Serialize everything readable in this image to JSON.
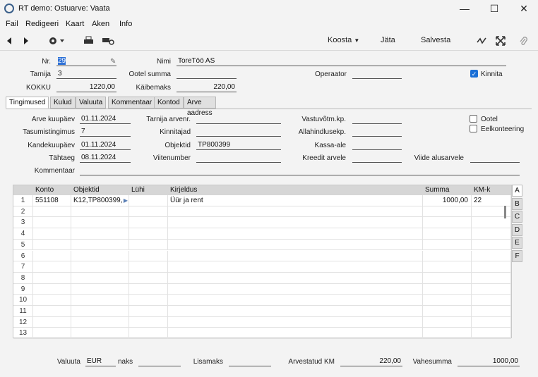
{
  "window": {
    "title": "RT demo: Ostuarve: Vaata",
    "minimize": "—",
    "maximize": "☐",
    "close": "✕"
  },
  "menu": [
    "Fail",
    "Redigeeri",
    "Kaart",
    "Aken",
    "Info"
  ],
  "toolbar": {
    "koosta": "Koosta",
    "jata": "Jäta",
    "salvesta": "Salvesta"
  },
  "header": {
    "nr_label": "Nr.",
    "nr_value": "29",
    "nimi_label": "Nimi",
    "nimi_value": "ToreTöö AS",
    "tarnija_label": "Tarnija",
    "tarnija_value": "3",
    "ootel_summa_label": "Ootel summa",
    "ootel_summa_value": "",
    "operaator_label": "Operaator",
    "operaator_value": "",
    "kinnita_label": "Kinnita",
    "kokku_label": "KOKKU",
    "kokku_value": "1220,00",
    "kaibemaks_label": "Käibemaks",
    "kaibemaks_value": "220,00"
  },
  "tabs": [
    "Tingimused",
    "Kulud",
    "Valuuta",
    "Kommentaar",
    "Kontod",
    "Arve aadress"
  ],
  "conditions": {
    "arve_kuupaev_label": "Arve kuupäev",
    "arve_kuupaev": "01.11.2024",
    "tarnija_arvenr_label": "Tarnija arvenr.",
    "tarnija_arvenr": "",
    "vastuvotm_label": "Vastuvõtm.kp.",
    "vastuvotm": "",
    "ootel_label": "Ootel",
    "tasumistingimus_label": "Tasumistingimus",
    "tasumistingimus": "7",
    "kinnitajad_label": "Kinnitajad",
    "kinnitajad": "",
    "allahindlusekp_label": "Allahindlusekp.",
    "allahindlusekp": "",
    "eelkonteering_label": "Eelkonteering",
    "kandekuupaev_label": "Kandekuupäev",
    "kandekuupaev": "01.11.2024",
    "objektid_label": "Objektid",
    "objektid": "TP800399",
    "kassa_ale_label": "Kassa-ale",
    "kassa_ale": "",
    "tahtaeg_label": "Tähtaeg",
    "tahtaeg": "08.11.2024",
    "viitenumber_label": "Viitenumber",
    "viitenumber": "",
    "kreedit_arvele_label": "Kreedit arvele",
    "kreedit_arvele": "",
    "viide_alusarvele_label": "Viide alusarvele",
    "viide_alusarvele": "",
    "kommentaar_label": "Kommentaar",
    "kommentaar": ""
  },
  "grid": {
    "columns": [
      "Konto",
      "Objektid",
      "Lühi",
      "Kirjeldus",
      "Summa",
      "KM-k"
    ],
    "rows": [
      {
        "n": "1",
        "konto": "551108",
        "objektid": "K12,TP800399,",
        "lyhi": "",
        "kirjeldus": "Üür ja rent",
        "summa": "1000,00",
        "kmk": "22"
      },
      {
        "n": "2"
      },
      {
        "n": "3"
      },
      {
        "n": "4"
      },
      {
        "n": "5"
      },
      {
        "n": "6"
      },
      {
        "n": "7"
      },
      {
        "n": "8"
      },
      {
        "n": "9"
      },
      {
        "n": "10"
      },
      {
        "n": "11"
      },
      {
        "n": "12"
      },
      {
        "n": "13"
      }
    ],
    "side_tabs": [
      "A",
      "B",
      "C",
      "D",
      "E",
      "F"
    ]
  },
  "footer": {
    "valuuta_label": "Valuuta",
    "valuuta_value": "EUR",
    "naks_label": "naks",
    "naks_value": "",
    "lisamaks_label": "Lisamaks",
    "lisamaks_value": "",
    "arvestatud_km_label": "Arvestatud KM",
    "arvestatud_km_value": "220,00",
    "vahesumma_label": "Vahesumma",
    "vahesumma_value": "1000,00"
  }
}
